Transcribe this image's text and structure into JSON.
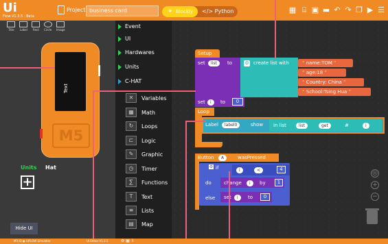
{
  "topbar": {
    "logo": "Ui",
    "version": "Flow  V1.3.5 - Beta",
    "project_label": "Project",
    "project_name": "business card",
    "mode_blockly": "Blockly",
    "mode_python": "</> Python"
  },
  "emulator": {
    "tools": [
      "Title",
      "Label",
      "Rect",
      "Circle",
      "Image"
    ],
    "screen_text": "Text",
    "device_logo": "M5",
    "tabs": [
      "Units",
      "Hat"
    ],
    "add_label": "+",
    "hide_ui": "Hide UI"
  },
  "categories_top": [
    "Event",
    "UI",
    "Hardwares",
    "Units",
    "C-HAT"
  ],
  "categories": [
    {
      "label": "Variables",
      "icon": "variables-icon",
      "glyph": "✕"
    },
    {
      "label": "Math",
      "icon": "math-icon",
      "glyph": "▦"
    },
    {
      "label": "Loops",
      "icon": "loops-icon",
      "glyph": "↻"
    },
    {
      "label": "Logic",
      "icon": "logic-icon",
      "glyph": "⊏"
    },
    {
      "label": "Graphic",
      "icon": "graphic-icon",
      "glyph": "✎"
    },
    {
      "label": "Timer",
      "icon": "timer-icon",
      "glyph": "◷"
    },
    {
      "label": "Functions",
      "icon": "functions-icon",
      "glyph": "∑"
    },
    {
      "label": "Text",
      "icon": "text-icon",
      "glyph": "T"
    },
    {
      "label": "Lists",
      "icon": "lists-icon",
      "glyph": "≡"
    },
    {
      "label": "Map",
      "icon": "map-icon",
      "glyph": "▤"
    }
  ],
  "blocks": {
    "setup": "Setup",
    "set": "set",
    "list_var": "list",
    "to": "to",
    "create_list": "create list with",
    "items": [
      "name:TOM",
      "age:18",
      "Country: China",
      "School:Tsing Hua"
    ],
    "set2": "set",
    "i_var": "i",
    "to2": "to",
    "zero": "0",
    "loop": "Loop",
    "label_kw": "Label",
    "label_name": "label0",
    "show": "show",
    "in_list": "in list",
    "list_ref": "list",
    "get": "get",
    "hash": "#",
    "i_ref": "i",
    "button": "Button",
    "button_name": "A",
    "pressed": "wasPressed",
    "if": "if",
    "i_cmp": "i",
    "lt": "<",
    "four": "4",
    "do": "do",
    "change": "change",
    "i_change": "i",
    "by": "by",
    "one": "1",
    "else": "else",
    "set3": "set",
    "i_set": "i",
    "to3": "to",
    "zero2": "0"
  },
  "bottombar": [
    "M5-ID  ●  UIFLOW Simulator",
    "UI Editor  V1.3.5"
  ],
  "colors": {
    "accent": "#f08a24",
    "purple": "#7a2fb5",
    "teal": "#2dbdb6",
    "text_block": "#e8673f",
    "label_block": "#34a8c2",
    "logic": "#4b5fd1"
  }
}
